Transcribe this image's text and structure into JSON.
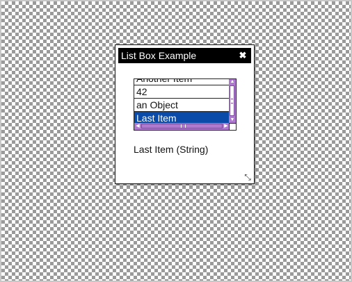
{
  "window": {
    "title": "List Box Example",
    "close_glyph": "✖",
    "resize_glyph": "⤡"
  },
  "listbox": {
    "items": [
      "Another Item",
      "42",
      "an Object",
      "Last Item"
    ],
    "selected_index": 3,
    "scroll_up_glyph": "▲",
    "scroll_down_glyph": "▼",
    "scroll_left_glyph": "◀",
    "scroll_right_glyph": "▶"
  },
  "status": {
    "text": "Last Item (String)"
  },
  "colors": {
    "titlebar": "#000000",
    "selection": "#0a4aa8",
    "scrollbar": "#b079d0"
  }
}
